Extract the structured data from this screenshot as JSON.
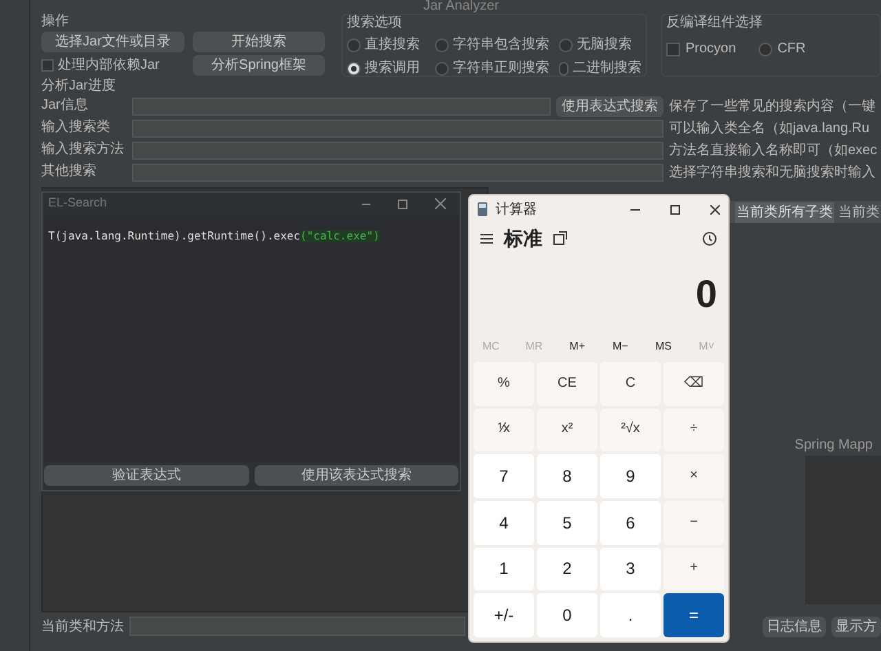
{
  "window": {
    "title": "Jar Analyzer"
  },
  "operations": {
    "title": "操作",
    "buttons": [
      "选择Jar文件或目录",
      "开始搜索",
      "分析Spring框架"
    ],
    "checkbox": {
      "label": "处理内部依赖Jar",
      "checked": false
    }
  },
  "search_options": {
    "title": "搜索选项",
    "radios": [
      {
        "label": "直接搜索",
        "selected": false
      },
      {
        "label": "字符串包含搜索",
        "selected": false
      },
      {
        "label": "无脑搜索",
        "selected": false
      },
      {
        "label": "搜索调用",
        "selected": true
      },
      {
        "label": "字符串正则搜索",
        "selected": false
      },
      {
        "label": "二进制搜索",
        "selected": false
      }
    ]
  },
  "decompiler": {
    "title": "反编译组件选择",
    "options": [
      {
        "label": "Procyon",
        "kind": "checkbox",
        "checked": false
      },
      {
        "label": "CFR",
        "kind": "radio",
        "checked": false
      }
    ]
  },
  "progress_label": "分析Jar进度",
  "fields": [
    {
      "label": "Jar信息",
      "button": "使用表达式搜索",
      "hint": "保存了一些常见的搜索内容（一键"
    },
    {
      "label": "输入搜索类",
      "hint": "可以输入类全名（如java.lang.Ru"
    },
    {
      "label": "输入搜索方法",
      "hint": "方法名直接输入名称即可（如exec"
    },
    {
      "label": "其他搜索",
      "hint": "选择字符串搜索和无脑搜索时输入"
    }
  ],
  "right_tabs": [
    {
      "label": "当前类所有子类",
      "selected": true
    },
    {
      "label": "当前类",
      "selected": false
    }
  ],
  "spring_label": "Spring Mapp",
  "bottom": {
    "label": "当前类和方法",
    "buttons": [
      "日志信息",
      "显示方"
    ]
  },
  "el_search": {
    "title": "EL-Search",
    "code_prefix": "T(java.lang.Runtime).getRuntime().exec",
    "code_arg": "(\"calc.exe\")",
    "buttons": [
      "验证表达式",
      "使用该表达式搜索"
    ]
  },
  "calculator": {
    "title": "计算器",
    "mode": "标准",
    "display": "0",
    "memory": [
      {
        "label": "MC",
        "disabled": true
      },
      {
        "label": "MR",
        "disabled": true
      },
      {
        "label": "M+",
        "disabled": false
      },
      {
        "label": "M−",
        "disabled": false
      },
      {
        "label": "MS",
        "disabled": false
      },
      {
        "label": "M˅",
        "disabled": true
      }
    ],
    "keys": [
      {
        "label": "%",
        "kind": "function"
      },
      {
        "label": "CE",
        "kind": "function"
      },
      {
        "label": "C",
        "kind": "function"
      },
      {
        "label": "⌫",
        "kind": "function"
      },
      {
        "label": "⅟x",
        "kind": "function"
      },
      {
        "label": "x²",
        "kind": "function"
      },
      {
        "label": "²√x",
        "kind": "function"
      },
      {
        "label": "÷",
        "kind": "function"
      },
      {
        "label": "7",
        "kind": "digit"
      },
      {
        "label": "8",
        "kind": "digit"
      },
      {
        "label": "9",
        "kind": "digit"
      },
      {
        "label": "×",
        "kind": "function"
      },
      {
        "label": "4",
        "kind": "digit"
      },
      {
        "label": "5",
        "kind": "digit"
      },
      {
        "label": "6",
        "kind": "digit"
      },
      {
        "label": "−",
        "kind": "function"
      },
      {
        "label": "1",
        "kind": "digit"
      },
      {
        "label": "2",
        "kind": "digit"
      },
      {
        "label": "3",
        "kind": "digit"
      },
      {
        "label": "+",
        "kind": "function"
      },
      {
        "label": "+/-",
        "kind": "digit"
      },
      {
        "label": "0",
        "kind": "digit"
      },
      {
        "label": ".",
        "kind": "digit"
      },
      {
        "label": "=",
        "kind": "equals"
      }
    ]
  }
}
